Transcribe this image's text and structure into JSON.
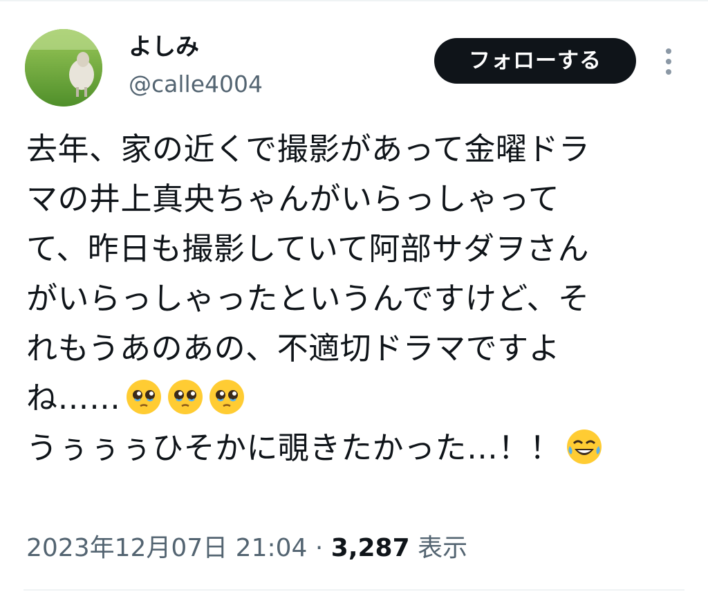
{
  "author": {
    "display_name": "よしみ",
    "handle": "@calle4004",
    "avatar_icon": "sheep-avatar-icon"
  },
  "actions": {
    "follow_label": "フォローする",
    "more_icon": "more-vertical-icon"
  },
  "tweet": {
    "lines": [
      "去年、家の近くで撮影があって金曜ドラ",
      "マの井上真央ちゃんがいらっしゃって",
      "て、昨日も撮影していて阿部サダヲさん",
      "がいらっしゃったというんですけど、そ",
      "れもうあのあの、不適切ドラマですよ",
      "ね……",
      "うぅぅぅひそかに覗きたかった…！！"
    ],
    "emoji_line6": [
      "pleading-face-emoji",
      "pleading-face-emoji",
      "pleading-face-emoji"
    ],
    "emoji_line7": [
      "tears-of-joy-emoji"
    ]
  },
  "meta": {
    "timestamp": "2023年12月07日 21:04",
    "separator": " · ",
    "views_count": "3,287",
    "views_label": " 表示"
  },
  "colors": {
    "text_primary": "#0f1419",
    "text_secondary": "#536471",
    "follow_bg": "#0f1419",
    "follow_text": "#ffffff",
    "divider": "#eff3f4",
    "emoji_face": "#ffcc33"
  }
}
